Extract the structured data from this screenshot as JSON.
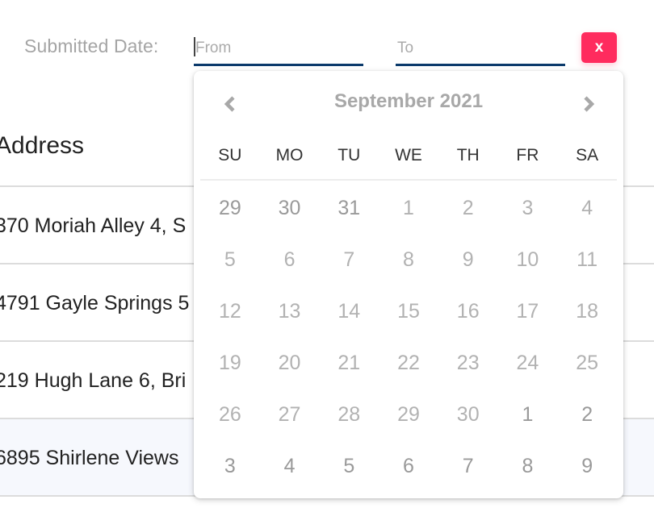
{
  "filter": {
    "label": "Submitted Date:",
    "from": {
      "value": "",
      "placeholder": "From"
    },
    "to": {
      "value": "",
      "placeholder": "To"
    },
    "clear_label": "x",
    "accent_color": "#ff2b5e",
    "underline_color": "#0b3a6b"
  },
  "table": {
    "header": "Address",
    "rows": [
      {
        "address": "370 Moriah Alley 4, S"
      },
      {
        "address": "4791 Gayle Springs 5"
      },
      {
        "address": "219 Hugh Lane 6, Bri"
      },
      {
        "address": "6895 Shirlene Views",
        "highlighted": true
      }
    ]
  },
  "calendar": {
    "title": "September 2021",
    "prev_icon": "chevron-left-icon",
    "next_icon": "chevron-right-icon",
    "weekdays": [
      "SU",
      "MO",
      "TU",
      "WE",
      "TH",
      "FR",
      "SA"
    ],
    "weeks": [
      [
        {
          "d": "29",
          "other": true
        },
        {
          "d": "30",
          "other": true
        },
        {
          "d": "31",
          "other": true
        },
        {
          "d": "1"
        },
        {
          "d": "2"
        },
        {
          "d": "3"
        },
        {
          "d": "4"
        }
      ],
      [
        {
          "d": "5"
        },
        {
          "d": "6"
        },
        {
          "d": "7"
        },
        {
          "d": "8"
        },
        {
          "d": "9"
        },
        {
          "d": "10"
        },
        {
          "d": "11"
        }
      ],
      [
        {
          "d": "12"
        },
        {
          "d": "13"
        },
        {
          "d": "14"
        },
        {
          "d": "15"
        },
        {
          "d": "16"
        },
        {
          "d": "17"
        },
        {
          "d": "18"
        }
      ],
      [
        {
          "d": "19"
        },
        {
          "d": "20"
        },
        {
          "d": "21"
        },
        {
          "d": "22"
        },
        {
          "d": "23"
        },
        {
          "d": "24"
        },
        {
          "d": "25"
        }
      ],
      [
        {
          "d": "26"
        },
        {
          "d": "27"
        },
        {
          "d": "28"
        },
        {
          "d": "29"
        },
        {
          "d": "30"
        },
        {
          "d": "1",
          "other": true
        },
        {
          "d": "2",
          "other": true
        }
      ],
      [
        {
          "d": "3",
          "other": true
        },
        {
          "d": "4",
          "other": true
        },
        {
          "d": "5",
          "other": true
        },
        {
          "d": "6",
          "other": true
        },
        {
          "d": "7",
          "other": true
        },
        {
          "d": "8",
          "other": true
        },
        {
          "d": "9",
          "other": true
        }
      ]
    ]
  }
}
